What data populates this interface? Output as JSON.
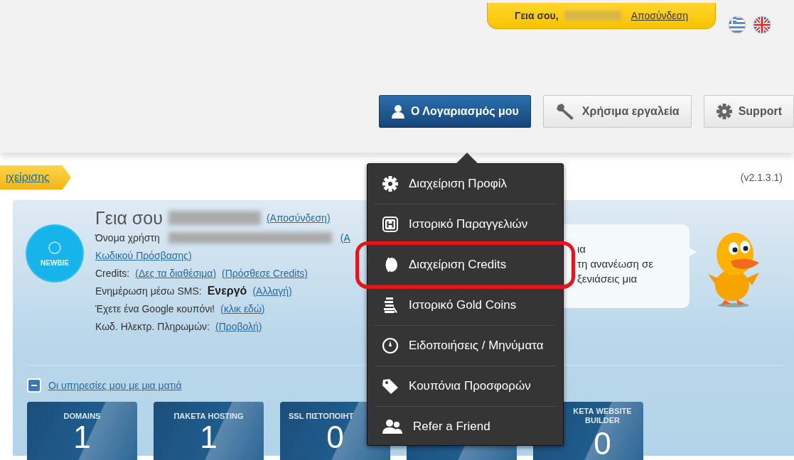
{
  "header": {
    "greeting": "Γεια σου,",
    "logout": "Αποσύνδεση"
  },
  "nav": [
    {
      "label": "Ο Λογαριασμός μου",
      "kind": "user",
      "selected": true
    },
    {
      "label": "Χρήσιμα εργαλεία",
      "kind": "wrench",
      "selected": false
    },
    {
      "label": "Support",
      "kind": "gear",
      "selected": false
    }
  ],
  "breadcrumb": "ιχείρισης",
  "version": "(v2.1.3.1)",
  "profile": {
    "badge": "NEWBIE",
    "greeting": "Γεια σου",
    "logout": "(Αποσύνδεση)",
    "lines": [
      [
        {
          "kind": "label",
          "text": "Όνομα χρήστη"
        },
        {
          "kind": "redacted"
        },
        {
          "kind": "link",
          "text": "(Α"
        }
      ],
      [
        {
          "kind": "link",
          "text": "Κωδικού Πρόσβασης)"
        }
      ],
      [
        {
          "kind": "label",
          "text": "Credits:"
        },
        {
          "kind": "link",
          "text": "(Δες τα διαθέσιμα)"
        },
        {
          "kind": "link",
          "text": "(Πρόσθεσε Credits)"
        }
      ],
      [
        {
          "kind": "label",
          "text": "Ενημέρωση μέσω SMS:"
        },
        {
          "kind": "bold",
          "text": "Ενεργό"
        },
        {
          "kind": "link",
          "text": "(Αλλαγή)"
        }
      ],
      [
        {
          "kind": "label",
          "text": "Έχετε ένα Google κουπόνι!"
        },
        {
          "kind": "link",
          "text": "(κλικ εδώ)"
        }
      ],
      [
        {
          "kind": "label",
          "text": "Κωδ. Ηλεκτρ. Πληρωμών:"
        },
        {
          "kind": "link",
          "text": "(Προβολή)"
        }
      ]
    ]
  },
  "bubble": {
    "lines": [
      "ια",
      "τη ανανέωση σε",
      "ξενιάσεις μια"
    ]
  },
  "services_toggle": {
    "label": "Οι υπηρεσίες μου με μια ματιά",
    "expanded": true
  },
  "tiles": [
    {
      "kind": "count",
      "label_lines": [
        "DOMAINS"
      ],
      "value": "1"
    },
    {
      "kind": "count",
      "label_lines": [
        "ΠΑΚΕΤΑ HOSTING"
      ],
      "value": "1"
    },
    {
      "kind": "count",
      "label_lines": [
        "SSL ΠΙΣΤΟΠΟΙΗΤ"
      ],
      "value": "0"
    },
    {
      "kind": "covered"
    },
    {
      "kind": "count",
      "label_lines": [
        "ΚΕΤΑ WEBSITE",
        "BUILDER"
      ],
      "value": "0"
    }
  ],
  "menu": {
    "items": [
      {
        "label": "Διαχείριση Προφίλ",
        "kind": "gear",
        "highlighted": false
      },
      {
        "label": "Ιστορικό Παραγγελιών",
        "kind": "history",
        "highlighted": false
      },
      {
        "label": "Διαχείριση Credits",
        "kind": "coin",
        "highlighted": true
      },
      {
        "label": "Ιστορικό Gold Coins",
        "kind": "coins",
        "highlighted": false
      },
      {
        "label": "Ειδοποιήσεις / Μηνύματα",
        "kind": "clock",
        "highlighted": false
      },
      {
        "label": "Κουπόνια Προσφορών",
        "kind": "tag",
        "highlighted": false
      },
      {
        "label": "Refer a Friend",
        "kind": "people",
        "highlighted": false
      }
    ]
  }
}
